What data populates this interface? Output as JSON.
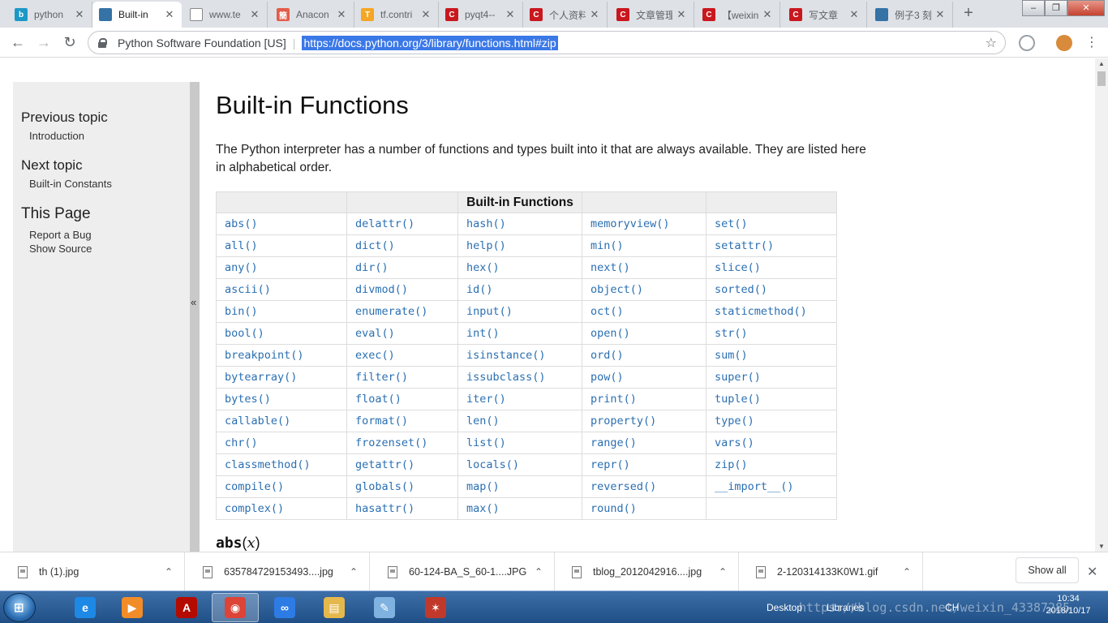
{
  "browser": {
    "tabs": [
      {
        "label": "python",
        "icon": "bing-icon",
        "color": "#1b98c7",
        "glyph": "b",
        "active": false
      },
      {
        "label": "Built-in",
        "icon": "python-logo-icon",
        "color": "#3572a5",
        "glyph": "",
        "active": true
      },
      {
        "label": "www.te",
        "icon": "page-icon",
        "color": "#ffffff",
        "glyph": "",
        "active": false
      },
      {
        "label": "Anacon",
        "icon": "jianshu-icon",
        "color": "#e45c4a",
        "glyph": "簡",
        "active": false
      },
      {
        "label": "tf.contri",
        "icon": "tensorflow-icon",
        "color": "#f5a623",
        "glyph": "T",
        "active": false
      },
      {
        "label": "pyqt4--",
        "icon": "csdn-icon",
        "color": "#c9171e",
        "glyph": "C",
        "active": false
      },
      {
        "label": "个人资料",
        "icon": "csdn-icon",
        "color": "#c9171e",
        "glyph": "C",
        "active": false
      },
      {
        "label": "文章管理",
        "icon": "csdn-icon",
        "color": "#c9171e",
        "glyph": "C",
        "active": false
      },
      {
        "label": "【weixin",
        "icon": "csdn-icon",
        "color": "#c9171e",
        "glyph": "C",
        "active": false
      },
      {
        "label": "写文章",
        "icon": "csdn-icon",
        "color": "#c9171e",
        "glyph": "C",
        "active": false
      },
      {
        "label": "例子3 刻",
        "icon": "python-logo-icon",
        "color": "#3572a5",
        "glyph": "",
        "active": false
      }
    ],
    "site_identity": "Python Software Foundation [US]",
    "url": "https://docs.python.org/3/library/functions.html#zip"
  },
  "sidebar": {
    "previous_heading": "Previous topic",
    "previous_link": "Introduction",
    "next_heading": "Next topic",
    "next_link": "Built-in Constants",
    "this_page_heading": "This Page",
    "report_link": "Report a Bug",
    "source_link": "Show Source",
    "collapse_glyph": "«"
  },
  "content": {
    "title": "Built-in Functions",
    "intro": "The Python interpreter has a number of functions and types built into it that are always available. They are listed here in alphabetical order.",
    "table_header": "Built-in Functions",
    "table_rows": [
      [
        "abs()",
        "delattr()",
        "hash()",
        "memoryview()",
        "set()"
      ],
      [
        "all()",
        "dict()",
        "help()",
        "min()",
        "setattr()"
      ],
      [
        "any()",
        "dir()",
        "hex()",
        "next()",
        "slice()"
      ],
      [
        "ascii()",
        "divmod()",
        "id()",
        "object()",
        "sorted()"
      ],
      [
        "bin()",
        "enumerate()",
        "input()",
        "oct()",
        "staticmethod()"
      ],
      [
        "bool()",
        "eval()",
        "int()",
        "open()",
        "str()"
      ],
      [
        "breakpoint()",
        "exec()",
        "isinstance()",
        "ord()",
        "sum()"
      ],
      [
        "bytearray()",
        "filter()",
        "issubclass()",
        "pow()",
        "super()"
      ],
      [
        "bytes()",
        "float()",
        "iter()",
        "print()",
        "tuple()"
      ],
      [
        "callable()",
        "format()",
        "len()",
        "property()",
        "type()"
      ],
      [
        "chr()",
        "frozenset()",
        "list()",
        "range()",
        "vars()"
      ],
      [
        "classmethod()",
        "getattr()",
        "locals()",
        "repr()",
        "zip()"
      ],
      [
        "compile()",
        "globals()",
        "map()",
        "reversed()",
        "__import__()"
      ],
      [
        "complex()",
        "hasattr()",
        "max()",
        "round()",
        ""
      ]
    ],
    "abs_name": "abs",
    "abs_arg": "x"
  },
  "downloads": {
    "items": [
      "th (1).jpg",
      "635784729153493....jpg",
      "60-124-BA_S_60-1....JPG",
      "tblog_2012042916....jpg",
      "2-120314133K0W1.gif"
    ],
    "show_all": "Show all"
  },
  "taskbar": {
    "desktop_label": "Desktop",
    "libraries_label": "Libraries",
    "lang": "CH",
    "time": "10:34",
    "date": "2018/10/17",
    "watermark": "https://blog.csdn.net/weixin_43387285",
    "apps": [
      {
        "name": "ie-icon",
        "color": "#1e88e5",
        "glyph": "e"
      },
      {
        "name": "media-player-icon",
        "color": "#f28c28",
        "glyph": "▶"
      },
      {
        "name": "acrobat-icon",
        "color": "#b30b00",
        "glyph": "A"
      },
      {
        "name": "chrome-icon",
        "color": "#db4437",
        "glyph": "◉"
      },
      {
        "name": "baidu-netdisk-icon",
        "color": "#2d7be5",
        "glyph": "∞"
      },
      {
        "name": "file-explorer-icon",
        "color": "#e5b84c",
        "glyph": "▤"
      },
      {
        "name": "paint-icon",
        "color": "#7fb2e0",
        "glyph": "✎"
      },
      {
        "name": "spider-app-icon",
        "color": "#c0392b",
        "glyph": "✶"
      }
    ]
  }
}
